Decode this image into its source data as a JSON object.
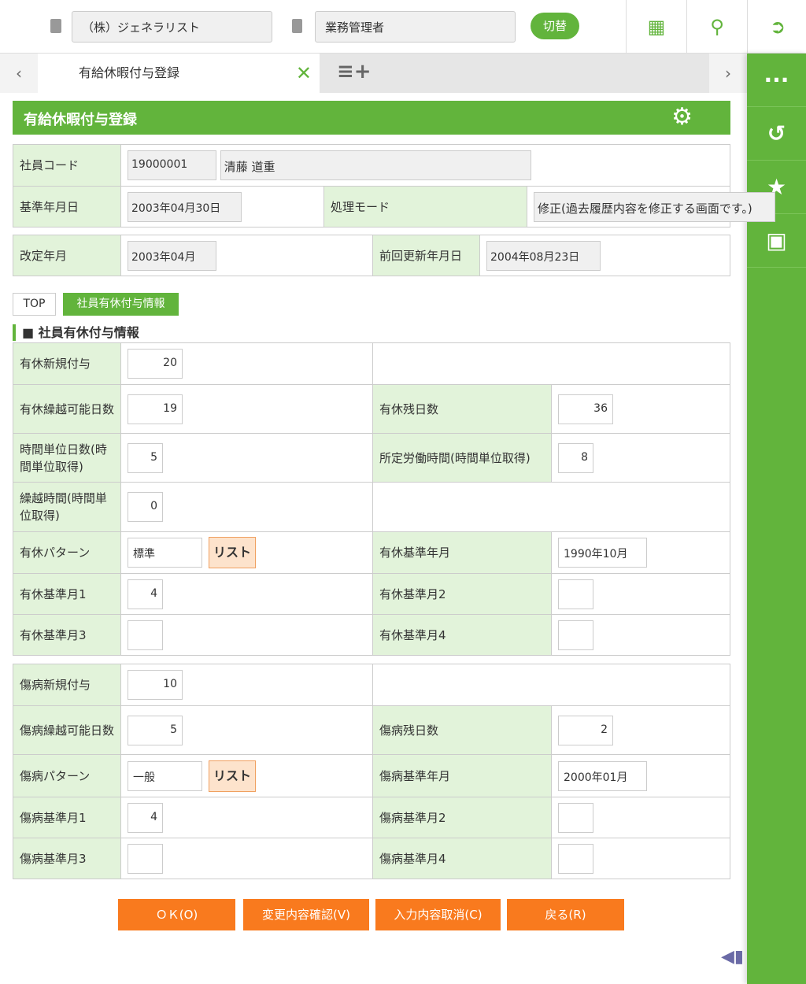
{
  "header": {
    "company": "（株）ジェネラリスト",
    "role": "業務管理者",
    "switch_label": "切替"
  },
  "tabs": {
    "active": "有給休暇付与登録"
  },
  "page": {
    "title": "有給休暇付与登録"
  },
  "info": {
    "emp_code_label": "社員コード",
    "emp_code": "19000001",
    "emp_name": "清藤 道重",
    "base_date_label": "基準年月日",
    "base_date": "2003年04月30日",
    "mode_label": "処理モード",
    "mode": "修正(過去履歴内容を修正する画面です。)",
    "rev_label": "改定年月",
    "rev": "2003年04月",
    "last_label": "前回更新年月日",
    "last": "2004年08月23日"
  },
  "subtabs": [
    "TOP",
    "社員有休付与情報"
  ],
  "section_title": "社員有休付与情報",
  "list_label": "リスト",
  "paid_rows": [
    [
      {
        "label": "有休新規付与",
        "value": "20",
        "kind": "num"
      },
      null
    ],
    [
      {
        "label": "有休繰越可能日数",
        "value": "19",
        "kind": "num"
      },
      {
        "label": "有休残日数",
        "value": "36",
        "kind": "num"
      }
    ],
    [
      {
        "label": "時間単位日数(時間単位取得)",
        "value": "5",
        "kind": "small"
      },
      {
        "label": "所定労働時間(時間単位取得)",
        "value": "8",
        "kind": "small"
      }
    ],
    [
      {
        "label": "繰越時間(時間単位取得)",
        "value": "0",
        "kind": "small"
      },
      null
    ],
    [
      {
        "label": "有休パターン",
        "value": "標準",
        "kind": "list"
      },
      {
        "label": "有休基準年月",
        "value": "1990年10月",
        "kind": "date"
      }
    ],
    [
      {
        "label": "有休基準月1",
        "value": "4",
        "kind": "small"
      },
      {
        "label": "有休基準月2",
        "value": "",
        "kind": "small"
      }
    ],
    [
      {
        "label": "有休基準月3",
        "value": "",
        "kind": "small"
      },
      {
        "label": "有休基準月4",
        "value": "",
        "kind": "small"
      }
    ]
  ],
  "sick_rows": [
    [
      {
        "label": "傷病新規付与",
        "value": "10",
        "kind": "num"
      },
      null
    ],
    [
      {
        "label": "傷病繰越可能日数",
        "value": "5",
        "kind": "num"
      },
      {
        "label": "傷病残日数",
        "value": "2",
        "kind": "num"
      }
    ],
    [
      {
        "label": "傷病パターン",
        "value": "一般",
        "kind": "list"
      },
      {
        "label": "傷病基準年月",
        "value": "2000年01月",
        "kind": "date"
      }
    ],
    [
      {
        "label": "傷病基準月1",
        "value": "4",
        "kind": "small"
      },
      {
        "label": "傷病基準月2",
        "value": "",
        "kind": "small"
      }
    ],
    [
      {
        "label": "傷病基準月3",
        "value": "",
        "kind": "small"
      },
      {
        "label": "傷病基準月4",
        "value": "",
        "kind": "small"
      }
    ]
  ],
  "buttons": {
    "ok": "ＯＫ(O)",
    "confirm": "変更内容確認(V)",
    "cancel": "入力内容取消(C)",
    "back": "戻る(R)"
  },
  "colors": {
    "accent": "#62b43c",
    "button": "#f97a1e",
    "label_bg": "#e2f3da"
  }
}
